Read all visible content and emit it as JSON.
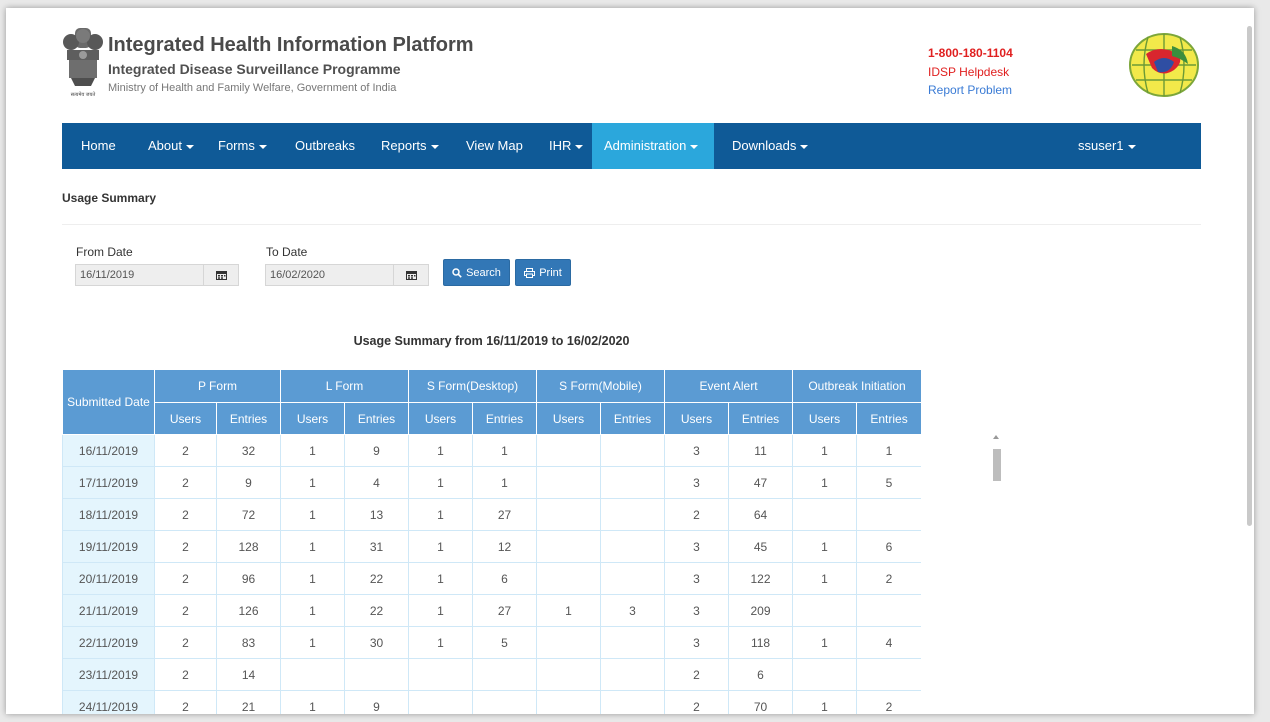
{
  "header": {
    "title": "Integrated Health Information Platform",
    "subtitle": "Integrated Disease Surveillance Programme",
    "ministry": "Ministry of Health and Family Welfare, Government of India",
    "emblem_caption": "सत्यमेव जयते",
    "helpline": "1-800-180-1104",
    "helpdesk": "IDSP Helpdesk",
    "report_problem": "Report Problem"
  },
  "nav": {
    "items": [
      {
        "label": "Home",
        "dropdown": false
      },
      {
        "label": "About",
        "dropdown": true
      },
      {
        "label": "Forms",
        "dropdown": true
      },
      {
        "label": "Outbreaks",
        "dropdown": false
      },
      {
        "label": "Reports",
        "dropdown": true
      },
      {
        "label": "View Map",
        "dropdown": false
      },
      {
        "label": "IHR",
        "dropdown": true
      },
      {
        "label": "Administration",
        "dropdown": true,
        "active": true
      },
      {
        "label": "Downloads",
        "dropdown": true
      }
    ],
    "user": "ssuser1"
  },
  "page": {
    "section_title": "Usage Summary",
    "from_label": "From Date",
    "from_value": "16/11/2019",
    "to_label": "To Date",
    "to_value": "16/02/2020",
    "search_label": "Search",
    "print_label": "Print",
    "summary_title": "Usage Summary from 16/11/2019 to 16/02/2020"
  },
  "table": {
    "first_header": "Submitted Date",
    "groups": [
      "P Form",
      "L Form",
      "S Form(Desktop)",
      "S Form(Mobile)",
      "Event Alert",
      "Outbreak Initiation"
    ],
    "users_label": "Users",
    "entries_label": "Entries",
    "rows": [
      [
        "16/11/2019",
        "2",
        "32",
        "1",
        "9",
        "1",
        "1",
        "",
        "",
        "3",
        "11",
        "1",
        "1"
      ],
      [
        "17/11/2019",
        "2",
        "9",
        "1",
        "4",
        "1",
        "1",
        "",
        "",
        "3",
        "47",
        "1",
        "5"
      ],
      [
        "18/11/2019",
        "2",
        "72",
        "1",
        "13",
        "1",
        "27",
        "",
        "",
        "2",
        "64",
        "",
        ""
      ],
      [
        "19/11/2019",
        "2",
        "128",
        "1",
        "31",
        "1",
        "12",
        "",
        "",
        "3",
        "45",
        "1",
        "6"
      ],
      [
        "20/11/2019",
        "2",
        "96",
        "1",
        "22",
        "1",
        "6",
        "",
        "",
        "3",
        "122",
        "1",
        "2"
      ],
      [
        "21/11/2019",
        "2",
        "126",
        "1",
        "22",
        "1",
        "27",
        "1",
        "3",
        "3",
        "209",
        "",
        ""
      ],
      [
        "22/11/2019",
        "2",
        "83",
        "1",
        "30",
        "1",
        "5",
        "",
        "",
        "3",
        "118",
        "1",
        "4"
      ],
      [
        "23/11/2019",
        "2",
        "14",
        "",
        "",
        "",
        "",
        "",
        "",
        "2",
        "6",
        "",
        ""
      ],
      [
        "24/11/2019",
        "2",
        "21",
        "1",
        "9",
        "",
        "",
        "",
        "",
        "2",
        "70",
        "1",
        "2"
      ]
    ]
  },
  "colors": {
    "nav_bg": "#0f5a97",
    "nav_active": "#2ba7dc",
    "table_header": "#5b9bd3",
    "date_cell": "#e4f5fd",
    "button": "#3277b6",
    "helpline": "#e02020",
    "link": "#3a7bd5"
  },
  "icons": {
    "calendar": "calendar-icon",
    "search": "search-icon",
    "print": "print-icon",
    "caret": "caret-down-icon"
  }
}
